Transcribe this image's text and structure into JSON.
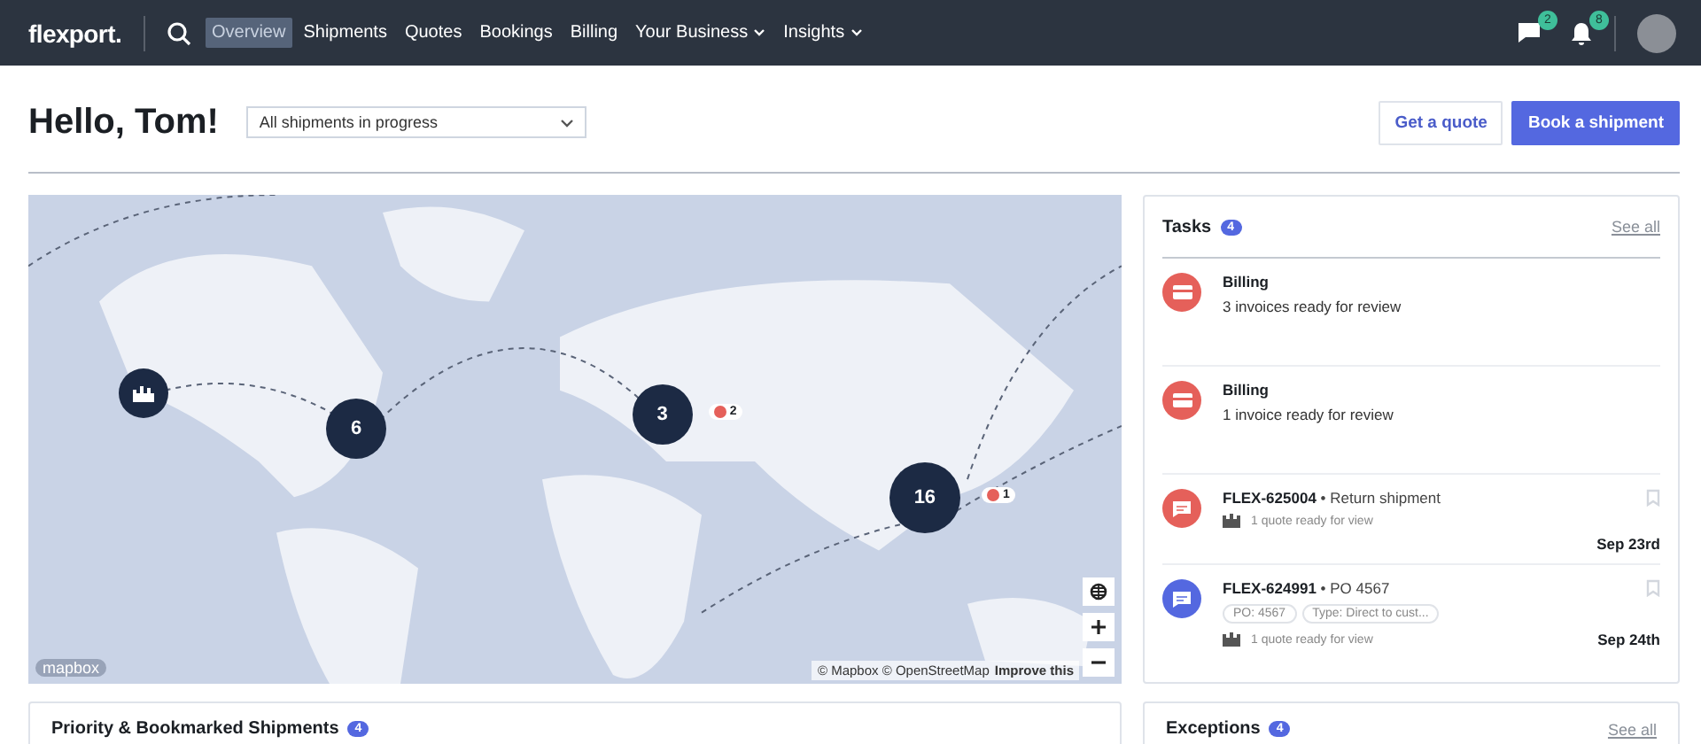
{
  "nav": {
    "logo": "flexport.",
    "items": [
      {
        "label": "Overview",
        "selected": true,
        "dropdown": false
      },
      {
        "label": "Shipments",
        "selected": false,
        "dropdown": false
      },
      {
        "label": "Quotes",
        "selected": false,
        "dropdown": false
      },
      {
        "label": "Bookings",
        "selected": false,
        "dropdown": false
      },
      {
        "label": "Billing",
        "selected": false,
        "dropdown": false
      },
      {
        "label": "Your Business",
        "selected": false,
        "dropdown": true
      },
      {
        "label": "Insights",
        "selected": false,
        "dropdown": true
      }
    ],
    "messages_count": "2",
    "notifications_count": "8"
  },
  "header": {
    "greeting": "Hello, Tom!",
    "filter": "All shipments in progress",
    "buttons": [
      {
        "label": "Get a quote",
        "kind": "secondary"
      },
      {
        "label": "Book a shipment",
        "kind": "primary"
      }
    ]
  },
  "map": {
    "clusters": [
      {
        "count": "6"
      },
      {
        "count": "3",
        "alert": "2"
      },
      {
        "count": "16",
        "alert": "1"
      }
    ],
    "logo": "mapbox",
    "attribution": "© Mapbox © OpenStreetMap",
    "improve_link": "Improve this"
  },
  "tasks": {
    "title": "Tasks",
    "count": "4",
    "see_all": "See all",
    "items": [
      {
        "kind": "billing",
        "color": "#e5605a",
        "title": "Billing",
        "description": "3 invoices ready for review"
      },
      {
        "kind": "billing",
        "color": "#e5605a",
        "title": "Billing",
        "description": "1 invoice ready for review"
      },
      {
        "kind": "shipment",
        "color": "#e5605a",
        "title": "FLEX-625004",
        "subtitle": "• Return shipment",
        "note": "1 quote ready for view",
        "date": "Sep 23rd"
      },
      {
        "kind": "shipment",
        "color": "#5468e0",
        "title": "FLEX-624991",
        "subtitle": "• PO 4567",
        "tags": [
          "PO: 4567",
          "Type: Direct to cust..."
        ],
        "note": "1 quote ready for view",
        "date": "Sep 24th"
      }
    ]
  },
  "priority": {
    "title": "Priority & Bookmarked Shipments",
    "count": "4"
  },
  "exceptions": {
    "title": "Exceptions",
    "count": "4",
    "see_all": "See all"
  }
}
